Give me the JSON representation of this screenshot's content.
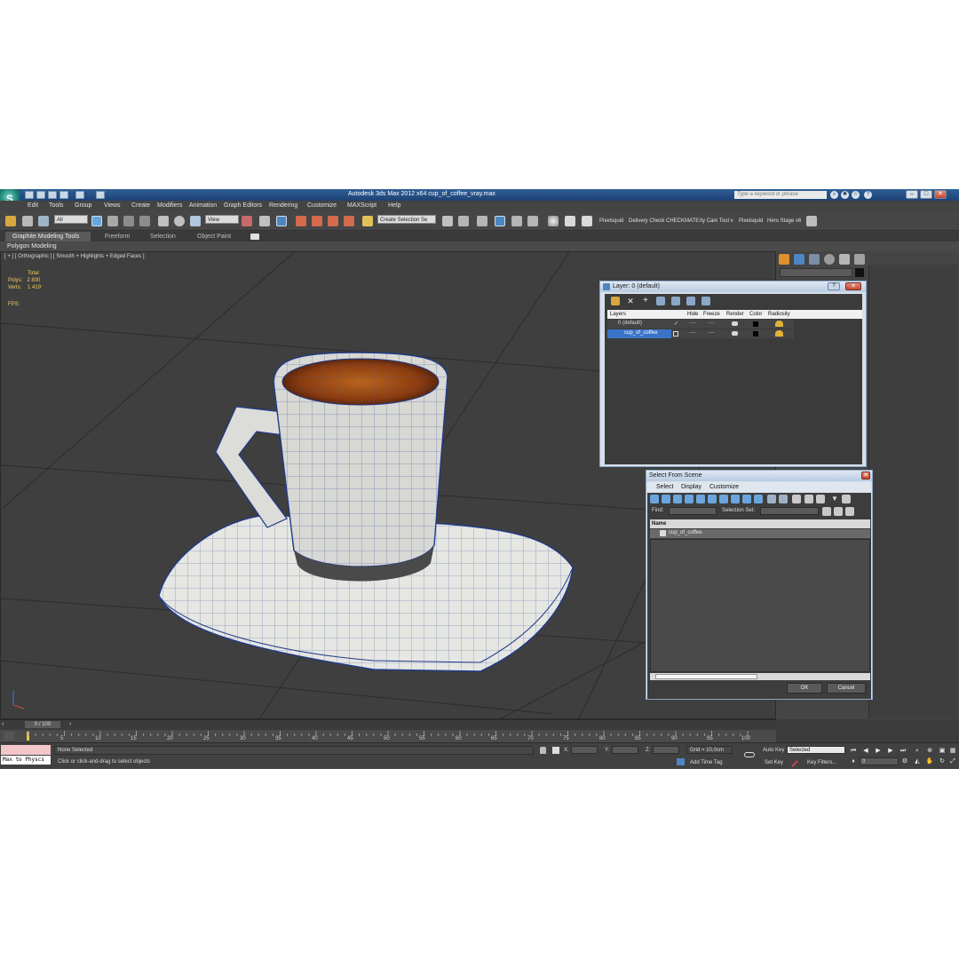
{
  "app": {
    "title": "Autodesk 3ds Max  2012 x64     cup_of_coffee_vray.max",
    "search_placeholder": "Type a keyword or phrase",
    "icon_letter": "S"
  },
  "menu": [
    "Edit",
    "Tools",
    "Group",
    "Views",
    "Create",
    "Modifiers",
    "Animation",
    "Graph Editors",
    "Rendering",
    "Customize",
    "MAXScript",
    "Help"
  ],
  "toolbar": {
    "filter_dropdown": "All",
    "refcoord_dropdown": "View",
    "selection_set": "Create Selection Se",
    "plugins": [
      "Pixelsquid",
      "Delivery Check",
      "CHECKMATE",
      "ity Cam Tool v",
      "Pixelsquid",
      "Hero Stage v6"
    ]
  },
  "ribbon": {
    "tabs": [
      "Graphite Modeling Tools",
      "Freeform",
      "Selection",
      "Object Paint"
    ],
    "panel": "Polygon Modeling"
  },
  "viewport": {
    "label": "[ + ] [ Orthographic ] [ Smooth + Highlights + Edged Faces ]",
    "stats": {
      "header": "Total",
      "polys_label": "Polys:",
      "polys": "2 800",
      "verts_label": "Verts:",
      "verts": "1 419"
    },
    "fps_label": "FPS:"
  },
  "layer_dialog": {
    "title": "Layer: 0 (default)",
    "columns": [
      "Layers",
      "Hide",
      "Freeze",
      "Render",
      "Color",
      "Radiosity"
    ],
    "rows": [
      {
        "name": "0 (default)",
        "hide": "----",
        "freeze": "----"
      },
      {
        "name": "cup_of_coffee",
        "hide": "----",
        "freeze": "----"
      }
    ]
  },
  "select_dialog": {
    "title": "Select From Scene",
    "menu": [
      "Select",
      "Display",
      "Customize"
    ],
    "find_label": "Find:",
    "selection_set_label": "Selection Set:",
    "column": "Name",
    "item": "cup_of_coffee",
    "ok": "OK",
    "cancel": "Cancel"
  },
  "timeline": {
    "frame": "0 / 100",
    "ticks": [
      "5",
      "10",
      "15",
      "20",
      "25",
      "30",
      "35",
      "40",
      "45",
      "50",
      "55",
      "60",
      "65",
      "70",
      "75",
      "80",
      "85",
      "90",
      "95",
      "100"
    ]
  },
  "status": {
    "maxscript": "Max to Physcs",
    "selection": "None Selected",
    "prompt": "Click or click-and-drag to select objects",
    "x_label": "X:",
    "y_label": "Y:",
    "z_label": "Z:",
    "grid": "Grid = 10,0cm",
    "add_time_tag": "Add Time Tag",
    "auto_key": "Auto Key",
    "set_key": "Set Key",
    "selected": "Selected",
    "key_filters": "Key Filters...",
    "current_frame": "0"
  }
}
